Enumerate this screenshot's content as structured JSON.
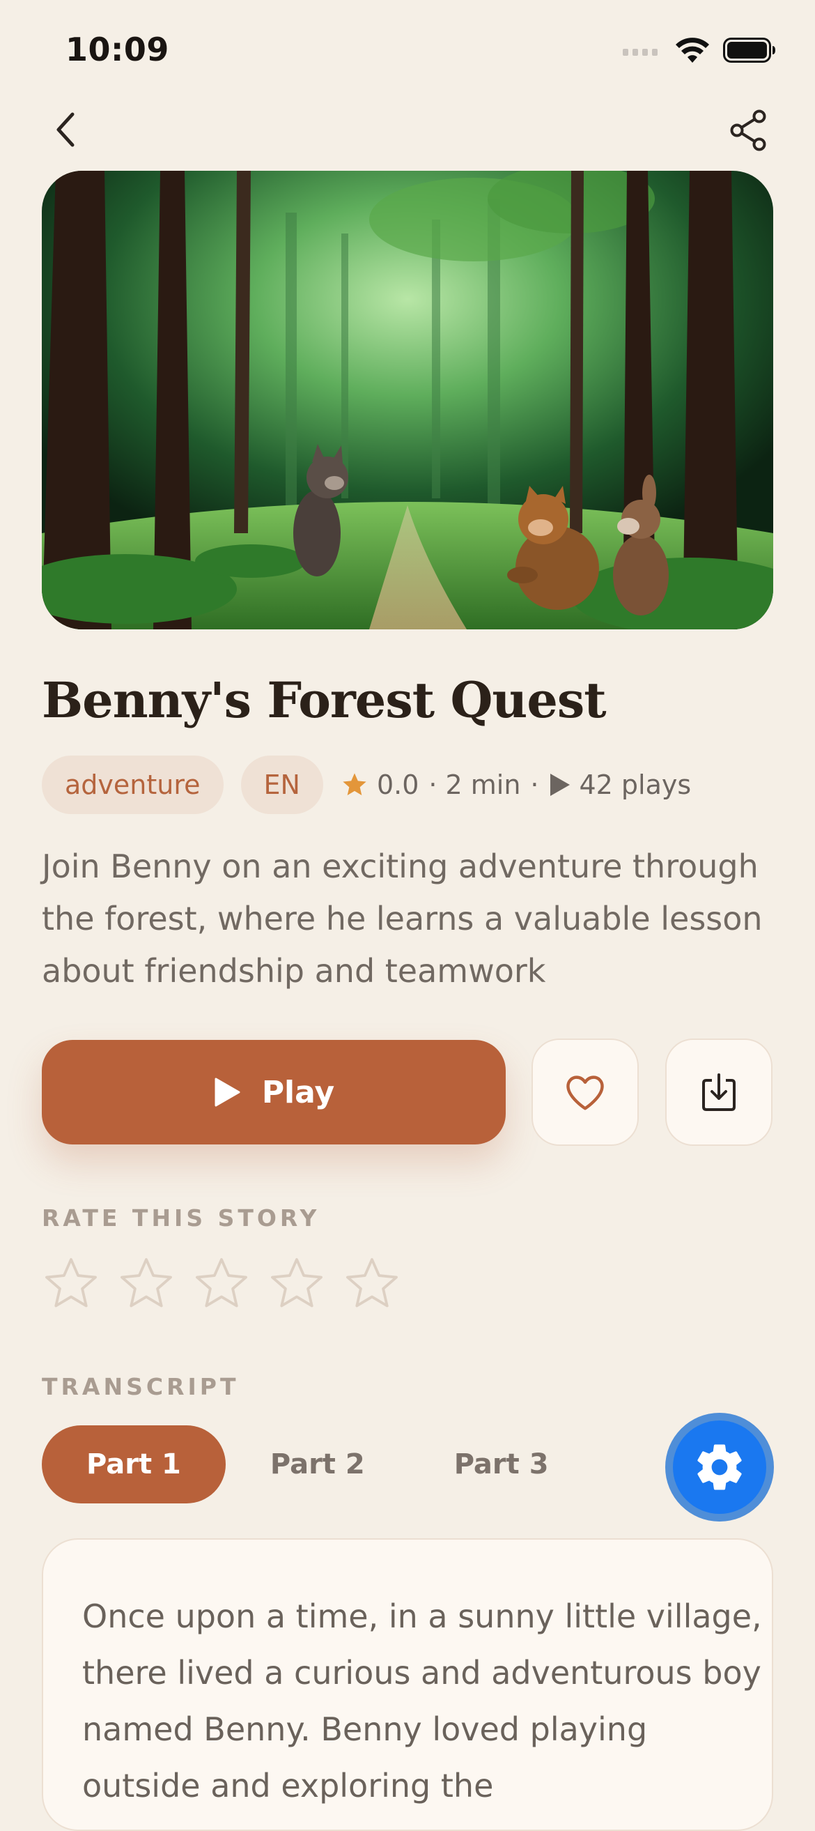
{
  "status_bar": {
    "time": "10:09"
  },
  "nav": {
    "back_icon": "chevron-left-icon",
    "share_icon": "share-icon"
  },
  "hero": {
    "alt": "Illustration of three animal friends on a forest path"
  },
  "story": {
    "title": "Benny's Forest Quest",
    "genre": "adventure",
    "language": "EN",
    "rating": "0.0",
    "duration": "2 min",
    "plays": "42 plays",
    "description": "Join Benny on an exciting adventure through the forest, where he learns a valuable lesson about friendship and teamwork"
  },
  "actions": {
    "play_label": "Play",
    "favorite_icon": "heart-icon",
    "download_icon": "download-icon"
  },
  "rating_section": {
    "label": "RATE THIS STORY",
    "stars_total": 5,
    "stars_selected": 0
  },
  "transcript": {
    "label": "TRANSCRIPT",
    "tabs": [
      {
        "label": "Part 1",
        "active": true
      },
      {
        "label": "Part 2",
        "active": false
      },
      {
        "label": "Part 3",
        "active": false
      }
    ],
    "text": "Once upon a time, in a sunny little village, there lived a curious and adventurous boy named Benny. Benny loved playing outside and exploring the"
  },
  "fab": {
    "icon": "gear-icon"
  },
  "colors": {
    "background": "#f5efe6",
    "accent": "#b8613a",
    "chip_bg": "#efe1d5",
    "star": "#e3963a",
    "fab_blue": "#1a78f0"
  }
}
